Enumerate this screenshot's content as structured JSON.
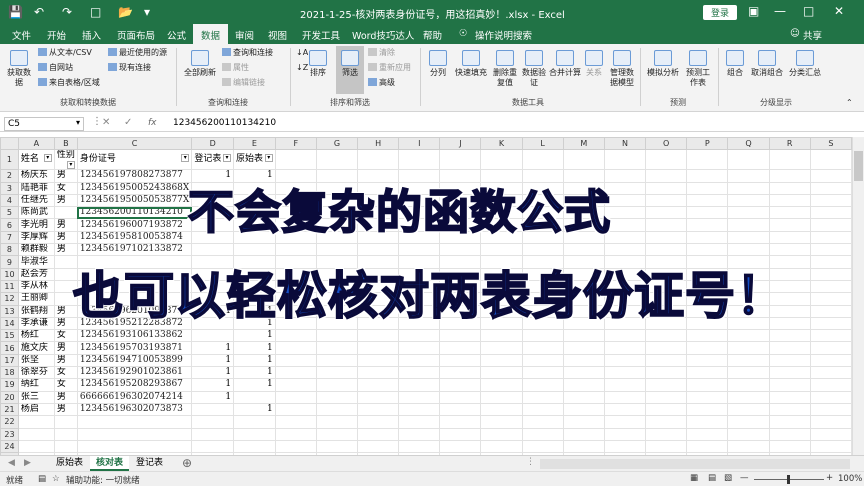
{
  "title_bar": {
    "document_title": "2021-1-25-核对两表身份证号，用这招真妙！.xlsx - Excel",
    "login_label": "登录"
  },
  "tabs": [
    "文件",
    "开始",
    "插入",
    "页面布局",
    "公式",
    "数据",
    "审阅",
    "视图",
    "开发工具",
    "Word技巧达人",
    "帮助",
    "操作说明搜索",
    "共享"
  ],
  "ribbon": {
    "get_data": "获取数据",
    "from_text_csv": "从文本/CSV",
    "from_web": "自网站",
    "from_table": "来自表格/区域",
    "recent_sources": "最近使用的源",
    "existing_connections": "现有连接",
    "group_get": "获取和转换数据",
    "refresh_all": "全部刷新",
    "queries_connections": "查询和连接",
    "properties": "属性",
    "edit_links": "编辑链接",
    "group_query": "查询和连接",
    "sort": "排序",
    "filter": "筛选",
    "clear": "清除",
    "reapply": "重新应用",
    "advanced": "高级",
    "group_sort": "排序和筛选",
    "split": "分列",
    "flash_fill": "快速填充",
    "remove_dup": "删除重复值",
    "validation": "数据验证",
    "consolidate": "合并计算",
    "relations": "关系",
    "manage_model": "管理数据模型",
    "group_tools": "数据工具",
    "what_if": "模拟分析",
    "forecast_sheet": "预测工作表",
    "group_forecast": "预测",
    "group_btn": "组合",
    "ungroup_btn": "取消组合",
    "subtotal": "分类汇总",
    "group_outline": "分级显示"
  },
  "formula_bar": {
    "name_box": "C5",
    "value": "123456200110134210",
    "fx": "fx"
  },
  "columns": [
    "A",
    "B",
    "C",
    "D",
    "E",
    "F",
    "G",
    "H",
    "I",
    "J",
    "K",
    "L",
    "M",
    "N",
    "O",
    "P",
    "Q",
    "R",
    "S"
  ],
  "headers": [
    "姓名",
    "性别",
    "身份证号",
    "登记表",
    "原始表"
  ],
  "rows": [
    [
      "杨庆东",
      "男",
      "123456197808273877",
      "1",
      "1"
    ],
    [
      "陆艳菲",
      "女",
      "123456195005243868X",
      "",
      ""
    ],
    [
      "任继先",
      "男",
      "123456195005053877X",
      "",
      ""
    ],
    [
      "陈尚武",
      "",
      "123456200110134210",
      "",
      ""
    ],
    [
      "李光明",
      "男",
      "123456196007193872",
      "",
      ""
    ],
    [
      "李厚辉",
      "男",
      "123456195810053874",
      "",
      ""
    ],
    [
      "赖群毅",
      "男",
      "123456197102133872",
      "",
      ""
    ],
    [
      "毕淑华",
      "",
      "",
      "",
      ""
    ],
    [
      "赵会芳",
      "",
      "",
      "",
      ""
    ],
    [
      "李从林",
      "",
      "",
      "",
      ""
    ],
    [
      "王丽卿",
      "",
      "",
      "",
      ""
    ],
    [
      "张鹤翔",
      "男",
      "123456196201093875",
      "1",
      "1"
    ],
    [
      "李承谦",
      "男",
      "123456195212283872",
      "",
      "1"
    ],
    [
      "杨红",
      "女",
      "123456193106133862",
      "",
      "1"
    ],
    [
      "施文庆",
      "男",
      "123456195703193871",
      "1",
      "1"
    ],
    [
      "张坚",
      "男",
      "123456194710053899",
      "1",
      "1"
    ],
    [
      "徐翠芬",
      "女",
      "123456192901023861",
      "1",
      "1"
    ],
    [
      "纳红",
      "女",
      "123456195208293867",
      "1",
      "1"
    ],
    [
      "张三",
      "男",
      "666666196302074214",
      "1",
      ""
    ],
    [
      "杨启",
      "男",
      "123456196302073873",
      "",
      "1"
    ]
  ],
  "sheets": [
    "原始表",
    "核对表",
    "登记表"
  ],
  "active_sheet": "核对表",
  "status": {
    "mode": "就绪",
    "accessibility": "辅助功能: 一切就绪",
    "zoom": "100%"
  },
  "overlay": {
    "line1": "不会复杂的函数公式",
    "line2": "也可以轻松核对两表身份证号！"
  }
}
